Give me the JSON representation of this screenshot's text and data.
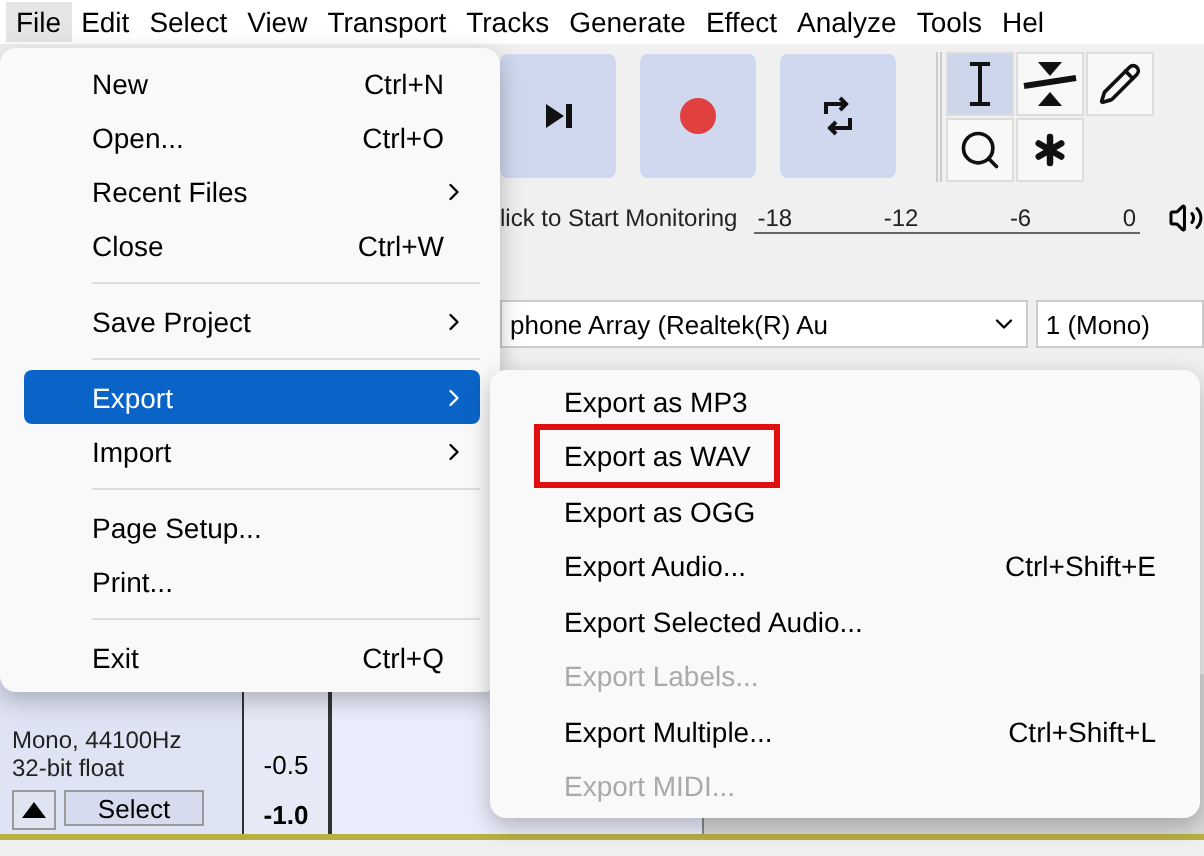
{
  "menu_bar": [
    {
      "label": "File",
      "open": true
    },
    {
      "label": "Edit",
      "open": false
    },
    {
      "label": "Select",
      "open": false
    },
    {
      "label": "View",
      "open": false
    },
    {
      "label": "Transport",
      "open": false
    },
    {
      "label": "Tracks",
      "open": false
    },
    {
      "label": "Generate",
      "open": false
    },
    {
      "label": "Effect",
      "open": false
    },
    {
      "label": "Analyze",
      "open": false
    },
    {
      "label": "Tools",
      "open": false
    },
    {
      "label": "Hel",
      "open": false
    }
  ],
  "transport_buttons": [
    {
      "kind": "skip-end"
    },
    {
      "kind": "record"
    },
    {
      "kind": "loop"
    }
  ],
  "tools": [
    {
      "kind": "select",
      "selected": true
    },
    {
      "kind": "envelope",
      "selected": false
    },
    {
      "kind": "draw",
      "selected": false
    },
    {
      "kind": "zoom",
      "selected": false
    },
    {
      "kind": "multi",
      "selected": false
    }
  ],
  "meter": {
    "label": "lick to Start Monitoring",
    "ticks": [
      "-18",
      "-12",
      "-6",
      "0"
    ]
  },
  "device_bar": {
    "input_device": "phone Array (Realtek(R) Au",
    "channels": "1 (Mono)"
  },
  "track": {
    "format": "Mono, 44100Hz",
    "sample_format": "32-bit float",
    "select_button": "Select",
    "scale": [
      "-0.5",
      "-1.0"
    ]
  },
  "file_menu": [
    {
      "kind": "item",
      "label": "New",
      "shortcut": "Ctrl+N",
      "submenu": false,
      "selected": false
    },
    {
      "kind": "item",
      "label": "Open...",
      "shortcut": "Ctrl+O",
      "submenu": false,
      "selected": false
    },
    {
      "kind": "item",
      "label": "Recent Files",
      "submenu": true,
      "selected": false
    },
    {
      "kind": "item",
      "label": "Close",
      "shortcut": "Ctrl+W",
      "submenu": false,
      "selected": false
    },
    {
      "kind": "separator"
    },
    {
      "kind": "item",
      "label": "Save Project",
      "submenu": true,
      "selected": false
    },
    {
      "kind": "separator"
    },
    {
      "kind": "item",
      "label": "Export",
      "submenu": true,
      "selected": true
    },
    {
      "kind": "item",
      "label": "Import",
      "submenu": true,
      "selected": false
    },
    {
      "kind": "separator"
    },
    {
      "kind": "item",
      "label": "Page Setup...",
      "submenu": false,
      "selected": false
    },
    {
      "kind": "item",
      "label": "Print...",
      "submenu": false,
      "selected": false
    },
    {
      "kind": "separator"
    },
    {
      "kind": "item",
      "label": "Exit",
      "shortcut": "Ctrl+Q",
      "submenu": false,
      "selected": false
    }
  ],
  "export_submenu": [
    {
      "label": "Export as MP3",
      "disabled": false,
      "highlighted": false
    },
    {
      "label": "Export as WAV",
      "disabled": false,
      "highlighted": true
    },
    {
      "label": "Export as OGG",
      "disabled": false,
      "highlighted": false
    },
    {
      "label": "Export Audio...",
      "shortcut": "Ctrl+Shift+E",
      "disabled": false,
      "highlighted": false
    },
    {
      "label": "Export Selected Audio...",
      "disabled": false,
      "highlighted": false
    },
    {
      "label": "Export Labels...",
      "disabled": true,
      "highlighted": false
    },
    {
      "label": "Export Multiple...",
      "shortcut": "Ctrl+Shift+L",
      "disabled": false,
      "highlighted": false
    },
    {
      "label": "Export MIDI...",
      "disabled": true,
      "highlighted": false
    }
  ]
}
